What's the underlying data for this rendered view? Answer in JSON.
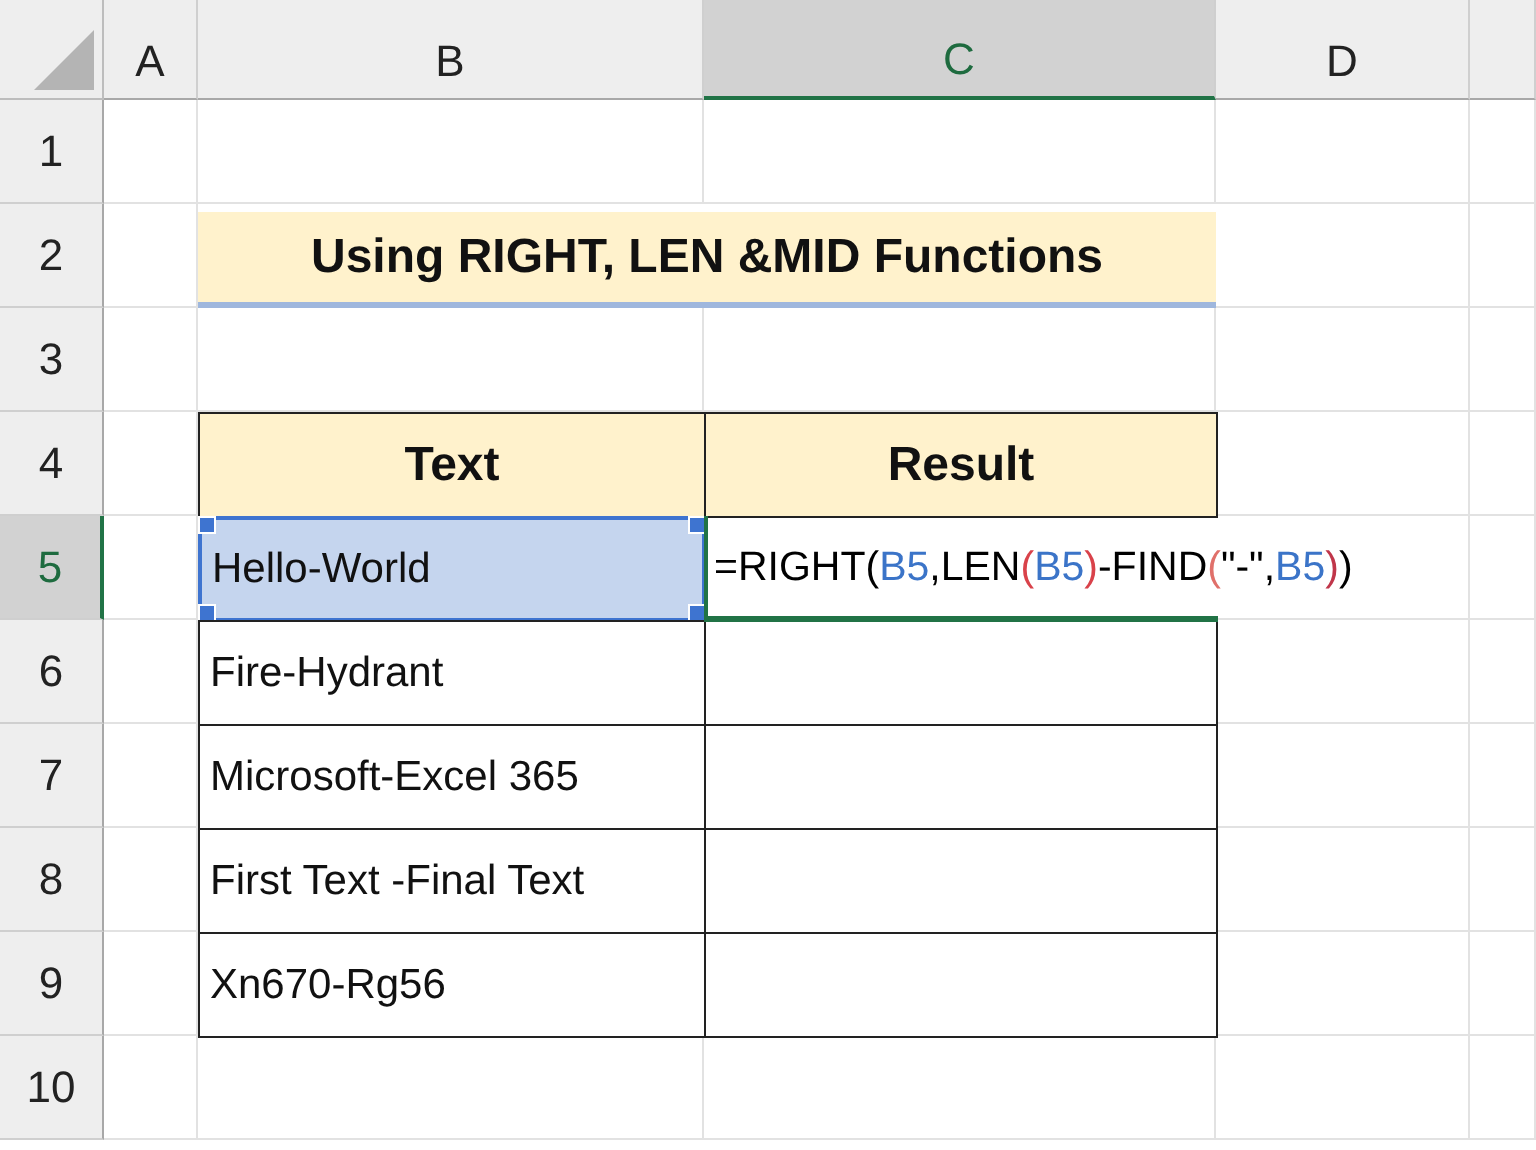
{
  "columns": [
    {
      "label": "A",
      "selected": false
    },
    {
      "label": "B",
      "selected": false
    },
    {
      "label": "C",
      "selected": true
    },
    {
      "label": "D",
      "selected": false
    }
  ],
  "rows": [
    {
      "label": "1",
      "selected": false
    },
    {
      "label": "2",
      "selected": false
    },
    {
      "label": "3",
      "selected": false
    },
    {
      "label": "4",
      "selected": false
    },
    {
      "label": "5",
      "selected": true
    },
    {
      "label": "6",
      "selected": false
    },
    {
      "label": "7",
      "selected": false
    },
    {
      "label": "8",
      "selected": false
    },
    {
      "label": "9",
      "selected": false
    },
    {
      "label": "10",
      "selected": false
    }
  ],
  "title": "Using RIGHT, LEN &MID Functions",
  "table": {
    "headers": [
      "Text",
      "Result"
    ],
    "rows": [
      {
        "text": "Hello-World",
        "selected": true,
        "formula": [
          {
            "text": "=RIGHT(",
            "color": "#000000"
          },
          {
            "text": "B5",
            "color": "#3b74c8"
          },
          {
            "text": ",LEN",
            "color": "#000000"
          },
          {
            "text": "(",
            "color": "#d9424a"
          },
          {
            "text": "B5",
            "color": "#3b74c8"
          },
          {
            "text": ")",
            "color": "#d9424a"
          },
          {
            "text": "-FIND",
            "color": "#000000"
          },
          {
            "text": "(",
            "color": "#e0706a"
          },
          {
            "text": "\"-\",",
            "color": "#000000"
          },
          {
            "text": "B5",
            "color": "#3b74c8"
          },
          {
            "text": ")",
            "color": "#c0364a"
          },
          {
            "text": ")",
            "color": "#000000"
          }
        ]
      },
      {
        "text": "Fire-Hydrant",
        "selected": false
      },
      {
        "text": "Microsoft-Excel 365",
        "selected": false
      },
      {
        "text": "First Text -Final Text",
        "selected": false
      },
      {
        "text": "Xn670-Rg56",
        "selected": false
      }
    ]
  }
}
